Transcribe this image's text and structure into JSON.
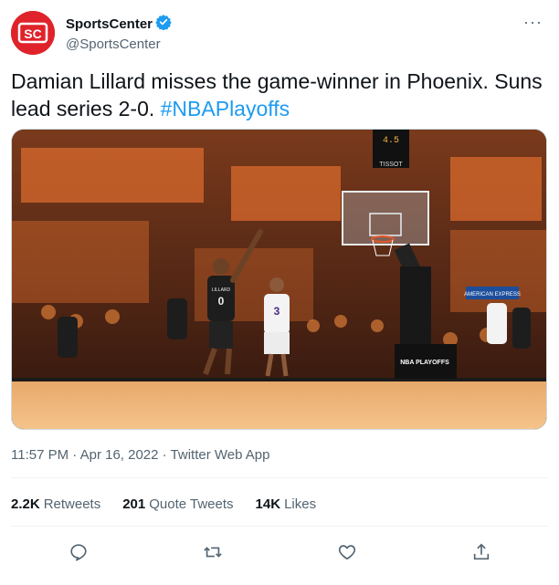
{
  "account": {
    "display_name": "SportsCenter",
    "handle": "@SportsCenter",
    "avatar_text": "SC",
    "verified_icon": "verified-badge-icon",
    "brand_color": "#e0232a",
    "verified_color": "#1d9bf0"
  },
  "tweet": {
    "text": "Damian Lillard misses the game-winner in Phoenix. Suns lead series 2-0. ",
    "hashtag": "#NBAPlayoffs",
    "timestamp": "11:57 PM · Apr 16, 2022 · Twitter Web App"
  },
  "media": {
    "description_icon": "basketball-game-screenshot",
    "scoreboard_clock": "4.5",
    "scoreboard_brand": "TISSOT",
    "stanchion_label": "NBA PLAYOFFS",
    "jersey_number_shooter": "0",
    "jersey_name_shooter": "LILLARD",
    "jersey_number_defender": "3",
    "banner_text": "AMERICAN EXPRESS"
  },
  "stats": {
    "retweets_count": "2.2K",
    "retweets_label": "Retweets",
    "quotes_count": "201",
    "quotes_label": "Quote Tweets",
    "likes_count": "14K",
    "likes_label": "Likes"
  },
  "actions": [
    "reply-icon",
    "retweet-icon",
    "like-icon",
    "share-icon"
  ],
  "more_label": "···"
}
